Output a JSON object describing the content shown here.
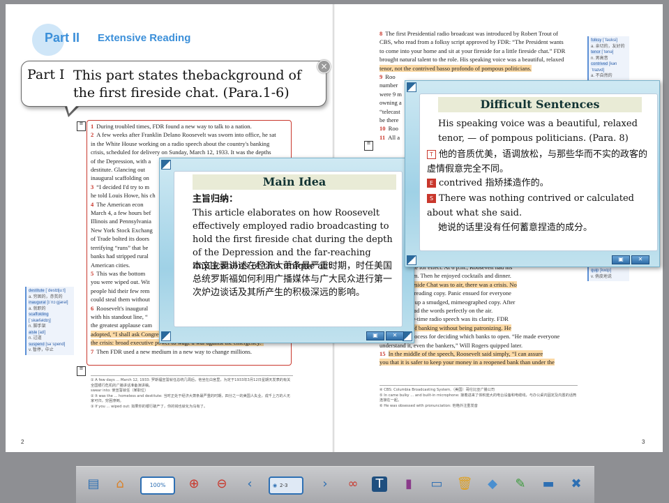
{
  "left_page": {
    "header_part": "Part II",
    "header_title": "Extensive Reading",
    "page_number": "2",
    "paragraphs": [
      {
        "n": "1",
        "text": "During troubled times, FDR found a new way to talk to a nation."
      },
      {
        "n": "2",
        "text": "A few weeks after Franklin Delano Roosevelt was sworn into office, he sat"
      },
      {
        "n": "",
        "text": "in the White House working on a radio speech about the country's banking"
      },
      {
        "n": "",
        "text": "crisis, scheduled for delivery on Sunday, March 12, 1933. It was the depths"
      },
      {
        "n": "",
        "text": "of the Depression, with a"
      },
      {
        "n": "",
        "text": "destitute. Glancing out"
      },
      {
        "n": "",
        "text": "inaugural scaffolding on"
      },
      {
        "n": "3",
        "text": "“I decided I'd try to m"
      },
      {
        "n": "",
        "text": "he told Louis Howe, his ch"
      },
      {
        "n": "4",
        "text": "The American econ"
      },
      {
        "n": "",
        "text": "March 4, a few hours bef"
      },
      {
        "n": "",
        "text": "Illinois and Pennsylvania"
      },
      {
        "n": "",
        "text": "New York Stock Exchang"
      },
      {
        "n": "",
        "text": "of Trade bolted its doors"
      },
      {
        "n": "",
        "text": "terrifying “runs” that be"
      },
      {
        "n": "",
        "text": "banks had stripped rural"
      },
      {
        "n": "",
        "text": "American cities."
      },
      {
        "n": "5",
        "text": "This was the bottom"
      },
      {
        "n": "",
        "text": "you were wiped out. Wit"
      },
      {
        "n": "",
        "text": "people hid their few rem"
      },
      {
        "n": "",
        "text": "could steal them without"
      },
      {
        "n": "6",
        "text": "Roosevelt's inaugural"
      },
      {
        "n": "",
        "text": "with his standout line, “"
      },
      {
        "n": "",
        "text": "the greatest applause cam"
      },
      {
        "n": "",
        "text": "adopted, “I shall ask Congress for the one remaining instrument to meet",
        "hl": true
      },
      {
        "n": "",
        "text": "the crisis: broad executive power to wage a war against the emergency.”",
        "hl": true
      },
      {
        "n": "7",
        "text": "Then FDR used a new medium in a new way to change millions."
      }
    ],
    "footnotes": [
      "① A few days ... March 12, 1933: 罗斯福宣誓就任总统几周后，他坐在白宫里，为定于1933年3月12日星期天发表的有关全国银行危机的广播讲话准备演讲稿。",
      "   swear into: 使宣誓就任（某职位）",
      "② It was the ... homeless and destitute: 当时正处于经济大萧条最严重的时期，四分之一的美国人失业，成千上万的人无家可归，穷困潦倒。",
      "③ If you ... wiped out: 如果你的银行破产了，你的钱也就化为乌有了。"
    ],
    "glossary": [
      {
        "word": "destitute",
        "pron": "[ˈdestɪtjuːt]",
        "def": "a. 穷困的，赤贫的"
      },
      {
        "word": "inaugural",
        "pron": "[ɪˈnɔːgjərəl]",
        "def": "a. 就职的"
      },
      {
        "word": "scaffolding",
        "pron": "[ˈskæfəldɪŋ]",
        "def": "n. 脚手架"
      },
      {
        "word": "aisle",
        "pron": "[aɪl]",
        "def": "n. 过道"
      },
      {
        "word": "suspend",
        "pron": "[səˈspend]",
        "def": "v. 暂停，中止"
      }
    ]
  },
  "right_page": {
    "page_number": "3",
    "paragraphs": [
      {
        "n": "8",
        "text": "The first Presidential radio broadcast was introduced by Robert Trout of"
      },
      {
        "n": "",
        "text": "CBS, who read from a folksy script approved by FDR: “The President wants"
      },
      {
        "n": "",
        "text": "to come into your home and sit at your fireside for a little fireside chat.” FDR"
      },
      {
        "n": "",
        "text": "brought natural talent to the role. His speaking voice was a beautiful, relaxed",
        "hl_from": "His speaking voice was a beautiful, relaxed"
      },
      {
        "n": "",
        "text": "tenor, not the contrived basso profondo of pompous politicians.",
        "hl": true
      },
      {
        "n": "9",
        "text": "Roo"
      },
      {
        "n": "",
        "text": "number"
      },
      {
        "n": "",
        "text": "were 9 m"
      },
      {
        "n": "",
        "text": "owning a"
      },
      {
        "n": "",
        "text": "“telecast"
      },
      {
        "n": "",
        "text": "be there"
      },
      {
        "n": "10",
        "text": "Roo"
      },
      {
        "n": "11",
        "text": "All a"
      }
    ],
    "paragraphs_lower": [
      {
        "n": "",
        "text": "djusted his pace for effect. At 6 p.m., Roosevelt had his"
      },
      {
        "n": "",
        "text": "a sinus problem. Then he enjoyed cocktails and dinner."
      },
      {
        "n": "",
        "text": "re the first Fireside Chat was to air, there was a crisis. No",
        "hl": true
      },
      {
        "n": "",
        "text": "leather-bound reading copy. Panic ensued for everyone"
      },
      {
        "n": "",
        "text": "calmly picked up a smudged, mimeographed copy. After"
      },
      {
        "n": "",
        "text": "of water, he read the words perfectly on the air."
      },
      {
        "n": "",
        "text": "that first prime-time radio speech was its clarity. FDR"
      },
      {
        "n": "",
        "text": "gh the basics of banking without being patronizing. He",
        "hl": true
      },
      {
        "n": "",
        "text": "outlined the process for deciding which banks to open. “He made everyone"
      },
      {
        "n": "",
        "text": "understand it, even the bankers,” Will Rogers quipped later."
      },
      {
        "n": "15",
        "text": "In the middle of the speech, Roosevelt said simply, “I can assure",
        "hl": true
      },
      {
        "n": "",
        "text": "you that it is safer to keep your money in a reopened bank than under the",
        "hl": true
      }
    ],
    "footnotes": [
      "④ CBS: Columbia Broadcasting System,（美国）哥伦比亚广播公司",
      "⑤ In came bulky ... and built-in microphone: 接着进来了体积庞大的电台设备和电缆线，与办公桌内固定及内置的话筒连接在一起。",
      "⑥ He was obsessed with pronunciation: 他格外注重发音"
    ],
    "glossary": [
      {
        "word": "folksy",
        "pron": "[ˈfəʊksi]",
        "def": "a. 亲切的，友好的"
      },
      {
        "word": "tenor",
        "pron": "[ˈtenə]",
        "def": "n. 男高音"
      },
      {
        "word": "contrived",
        "pron": "[kənˈtraɪvd]",
        "def": "a. 不自然的"
      }
    ],
    "glossary2": [
      {
        "word": "quip",
        "pron": "[kwɪp]",
        "def": "v. 俏皮地说"
      }
    ]
  },
  "callout": {
    "label": "Part I",
    "text": "This part states thebackground of the first fireside chat. (Para.1-6)",
    "close_label": "×"
  },
  "main_idea": {
    "title": "Main Idea",
    "subtitle": "主旨归纳：",
    "english": "This article elaborates on how Roosevelt effectively employed radio broadcasting to hold the first fireside chat during the depth of the Depression and the far-reaching implications of this unique act.",
    "chinese": "本文主要讲述在经济大萧条最严重时期，时任美国总统罗斯福如何利用广播媒体与广大民众进行第一次炉边谈话及其所产生的积极深远的影响。"
  },
  "difficult": {
    "title": "Difficult Sentences",
    "sentence": "His speaking voice was a beautiful, relaxed tenor, — of pompous politicians. (Para. 8)",
    "rows": [
      {
        "tag": "T",
        "text": "他的音质优美，语调放松，与那些华而不实的政客的虚情假意完全不同。"
      },
      {
        "tag": "E",
        "text": "contrived 指矫揉造作的。"
      },
      {
        "tag": "S",
        "text": "There was nothing contrived or calculated about what she said."
      },
      {
        "tag": "",
        "text": "她说的话里没有任何蓄意捏造的成分。"
      }
    ]
  },
  "toolbar": {
    "zoom": "100%",
    "page": "2-3"
  },
  "colors": {
    "accent": "#2d6fb3",
    "highlight": "#fbd9a5",
    "para_number": "#c9372c",
    "header_blue": "#3b8fd9"
  }
}
